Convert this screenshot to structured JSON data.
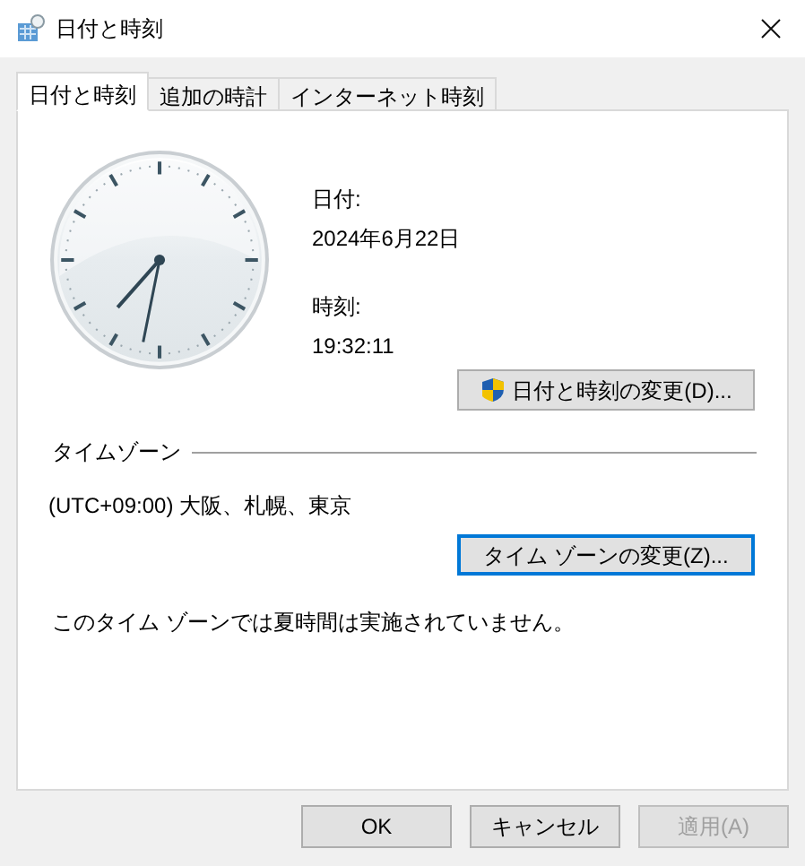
{
  "window": {
    "title": "日付と時刻"
  },
  "tabs": [
    {
      "label": "日付と時刻",
      "selected": true
    },
    {
      "label": "追加の時計",
      "selected": false
    },
    {
      "label": "インターネット時刻",
      "selected": false
    }
  ],
  "date_label": "日付:",
  "date": "2024年6月22日",
  "time_label": "時刻:",
  "time": "19:32:11",
  "change_datetime_button": {
    "label": "日付と時刻の変更(D)...",
    "focused": false
  },
  "timezone_heading": "タイムゾーン",
  "timezone": "(UTC+09:00) 大阪、札幌、東京",
  "change_timezone_button": {
    "label": "タイム ゾーンの変更(Z)...",
    "focused": true
  },
  "dst_note": "このタイム ゾーンでは夏時間は実施されていません。",
  "buttons": [
    {
      "label": "OK",
      "disabled": false
    },
    {
      "label": "キャンセル",
      "disabled": false
    },
    {
      "label": "適用(A)",
      "disabled": true
    }
  ]
}
